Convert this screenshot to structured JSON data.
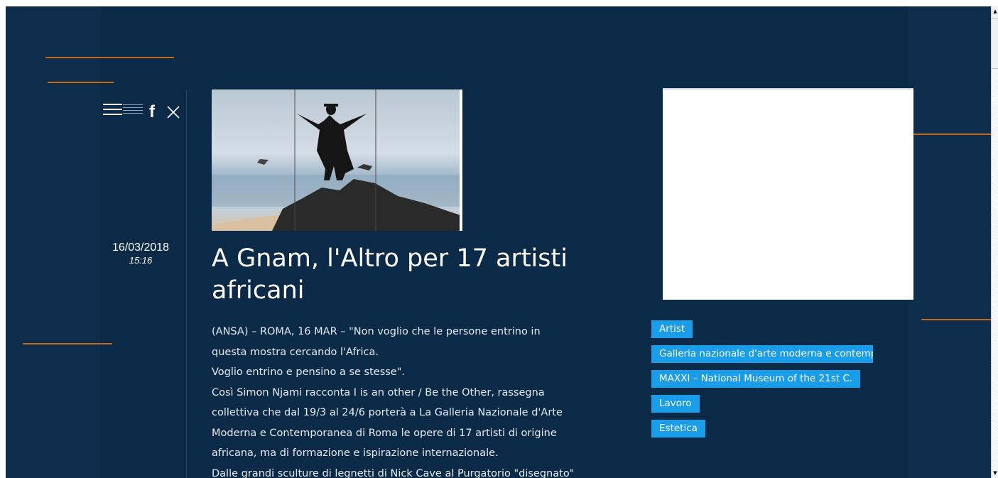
{
  "header": {
    "menu_icon": "hamburger-menu-icon",
    "share_icon": "facebook-icon",
    "close_icon": "close-icon"
  },
  "article": {
    "date": "16/03/2018",
    "time": "15:16",
    "title": "A Gnam, l'Altro per 17 artisti africani",
    "body": [
      "(ANSA) – ROMA, 16 MAR – \"Non voglio che le persone entrino in",
      "questa mostra cercando l'Africa.",
      "Voglio entrino e pensino a se stesse\".",
      "Così Simon Njami racconta I is an other / Be the Other, rassegna",
      "collettiva che dal 19/3 al 24/6 porterà a La Galleria Nazionale d'Arte",
      "Moderna e Contemporanea di Roma le opere di 17 artisti di origine",
      "africana, ma di formazione e ispirazione internazionale.",
      "Dalle grandi sculture di legnetti di Nick Cave al Purgatorio \"disegnato\""
    ]
  },
  "tags": [
    "Artist",
    "Galleria nazionale d'arte moderna e contemporanea",
    "MAXXI – National Museum of the 21st C.",
    "Lavoro",
    "Estetica"
  ],
  "colors": {
    "background": "#0e2c4c",
    "accent_line": "#c46a1f",
    "tag": "#1a9de8"
  }
}
